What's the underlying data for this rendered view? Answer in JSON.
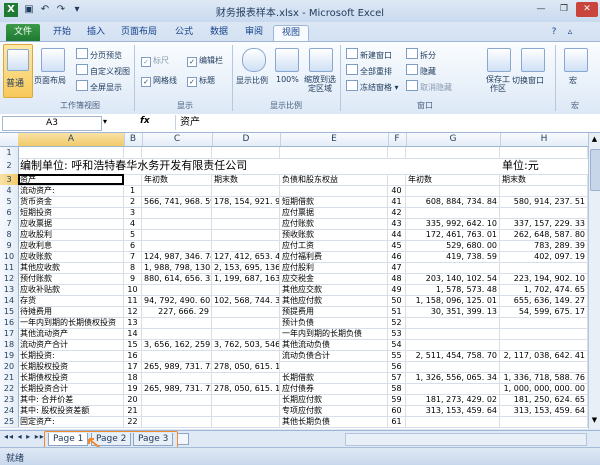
{
  "window": {
    "title": "财务报表样本.xlsx - Microsoft Excel"
  },
  "tabs": [
    "文件",
    "开始",
    "插入",
    "页面布局",
    "公式",
    "数据",
    "审阅",
    "视图"
  ],
  "ribbon": {
    "normal": "普通",
    "page_layout": "页面布局",
    "page_break": "分页预览",
    "custom_view": "自定义视图",
    "full_screen": "全屏显示",
    "grp_workbook": "工作簿视图",
    "ruler": "标尺",
    "formula_bar": "编辑栏",
    "gridlines": "网格线",
    "headings": "标题",
    "grp_show": "显示",
    "zoom": "显示比例",
    "zoom100": "100%",
    "zoom_sel": "缩放到选定区域",
    "grp_zoom": "显示比例",
    "new_window": "新建窗口",
    "arrange_all": "全部重排",
    "freeze": "冻结窗格",
    "split": "拆分",
    "hide": "隐藏",
    "unhide": "取消隐藏",
    "grp_window": "窗口",
    "save_ws": "保存工作区",
    "switch_win": "切换窗口",
    "macros": "宏",
    "grp_macro": "宏"
  },
  "formula": {
    "namebox": "A3",
    "fx": "fx",
    "value": "资产"
  },
  "columns": [
    "A",
    "B",
    "C",
    "D",
    "E",
    "F",
    "G",
    "H"
  ],
  "rows": [
    {
      "n": "1",
      "cells": [
        "",
        "",
        "",
        "",
        "",
        "",
        "",
        ""
      ]
    },
    {
      "n": "2",
      "cells": [
        "编制单位:  呼和浩特春华水务开发有限责任公司",
        "",
        "",
        "",
        "",
        "",
        "",
        "单位:元"
      ]
    },
    {
      "n": "3",
      "cells": [
        "资产",
        "",
        "年初数",
        "期末数",
        "负债和股东权益",
        "",
        "年初数",
        "期末数"
      ]
    },
    {
      "n": "4",
      "cells": [
        "流动资产:",
        "1",
        "",
        "",
        "",
        "40",
        "",
        ""
      ]
    },
    {
      "n": "5",
      "cells": [
        "货币资金",
        "2",
        "566, 741, 968. 59",
        "178, 154, 921. 98",
        "短期借款",
        "41",
        "608, 884, 734. 84",
        "580, 914, 237. 51"
      ]
    },
    {
      "n": "6",
      "cells": [
        "短期投资",
        "3",
        "",
        "",
        "应付票据",
        "42",
        "",
        ""
      ]
    },
    {
      "n": "7",
      "cells": [
        "应收票据",
        "4",
        "",
        "",
        "应付账款",
        "43",
        "335, 992, 642. 10",
        "337, 157, 229. 33"
      ]
    },
    {
      "n": "8",
      "cells": [
        "应收股利",
        "5",
        "",
        "",
        "预收账款",
        "44",
        "172, 461, 763. 01",
        "262, 648, 587. 80"
      ]
    },
    {
      "n": "9",
      "cells": [
        "应收利息",
        "6",
        "",
        "",
        "应付工资",
        "45",
        "529, 680. 00",
        "783, 289. 39"
      ]
    },
    {
      "n": "10",
      "cells": [
        "应收账款",
        "7",
        "124, 987, 346. 74",
        "127, 412, 653. 42",
        "应付福利费",
        "46",
        "419, 738. 59",
        "402, 097. 19"
      ]
    },
    {
      "n": "11",
      "cells": [
        "其他应收款",
        "8",
        "1, 988, 798, 130. 72",
        "2, 153, 695, 136. 84",
        "应付股利",
        "47",
        "",
        ""
      ]
    },
    {
      "n": "12",
      "cells": [
        "预付账款",
        "9",
        "880, 614, 656. 32",
        "1, 199, 687, 163. 94",
        "应交税金",
        "48",
        "203, 140, 102. 54",
        "223, 194, 902. 10"
      ]
    },
    {
      "n": "13",
      "cells": [
        "应收补贴款",
        "10",
        "",
        "",
        "其他应交款",
        "49",
        "1, 578, 573. 48",
        "1, 702, 474. 65"
      ]
    },
    {
      "n": "14",
      "cells": [
        "存货",
        "11",
        "94, 792, 490. 60",
        "102, 568, 744. 36",
        "其他应付款",
        "50",
        "1, 158, 096, 125. 01",
        "655, 636, 149. 27"
      ]
    },
    {
      "n": "15",
      "cells": [
        "待摊费用",
        "12",
        "227, 666. 29",
        "",
        "预提费用",
        "51",
        "30, 351, 399. 13",
        "54, 599, 675. 17"
      ]
    },
    {
      "n": "16",
      "cells": [
        "一年内到期的长期债权投资",
        "13",
        "",
        "",
        "预计负债",
        "52",
        "",
        ""
      ]
    },
    {
      "n": "17",
      "cells": [
        "其他流动资产",
        "14",
        "",
        "",
        "一年内到期的长期负债",
        "53",
        "",
        ""
      ]
    },
    {
      "n": "18",
      "cells": [
        "流动资产合计",
        "15",
        "3, 656, 162, 259. 26",
        "3, 762, 503, 546. 26",
        "其他流动负债",
        "54",
        "",
        ""
      ]
    },
    {
      "n": "19",
      "cells": [
        "长期投资:",
        "16",
        "",
        "",
        "流动负债合计",
        "55",
        "2, 511, 454, 758. 70",
        "2, 117, 038, 642. 41"
      ]
    },
    {
      "n": "20",
      "cells": [
        "长期股权投资",
        "17",
        "265, 989, 731. 72",
        "278, 050, 615. 14",
        "",
        "56",
        "",
        ""
      ]
    },
    {
      "n": "21",
      "cells": [
        "长期债权投资",
        "18",
        "",
        "",
        "长期借款",
        "57",
        "1, 326, 556, 065. 34",
        "1, 336, 718, 588. 76"
      ]
    },
    {
      "n": "22",
      "cells": [
        "长期投资合计",
        "19",
        "265, 989, 731. 72",
        "278, 050, 615. 14",
        "应付债券",
        "58",
        "",
        "1, 000, 000, 000. 00"
      ]
    },
    {
      "n": "23",
      "cells": [
        "其中: 合并价差",
        "20",
        "",
        "",
        "长期应付款",
        "59",
        "181, 273, 429. 02",
        "181, 250, 624. 65"
      ]
    },
    {
      "n": "24",
      "cells": [
        "其中: 股权投资差额",
        "21",
        "",
        "",
        "专项应付款",
        "60",
        "313, 153, 459. 64",
        "313, 153, 459. 64"
      ]
    },
    {
      "n": "25",
      "cells": [
        "固定资产:",
        "22",
        "",
        "",
        "其他长期负债",
        "61",
        "",
        ""
      ]
    }
  ],
  "sheets": [
    "Page 1",
    "Page 2",
    "Page 3"
  ],
  "status": {
    "ready": "就绪"
  }
}
